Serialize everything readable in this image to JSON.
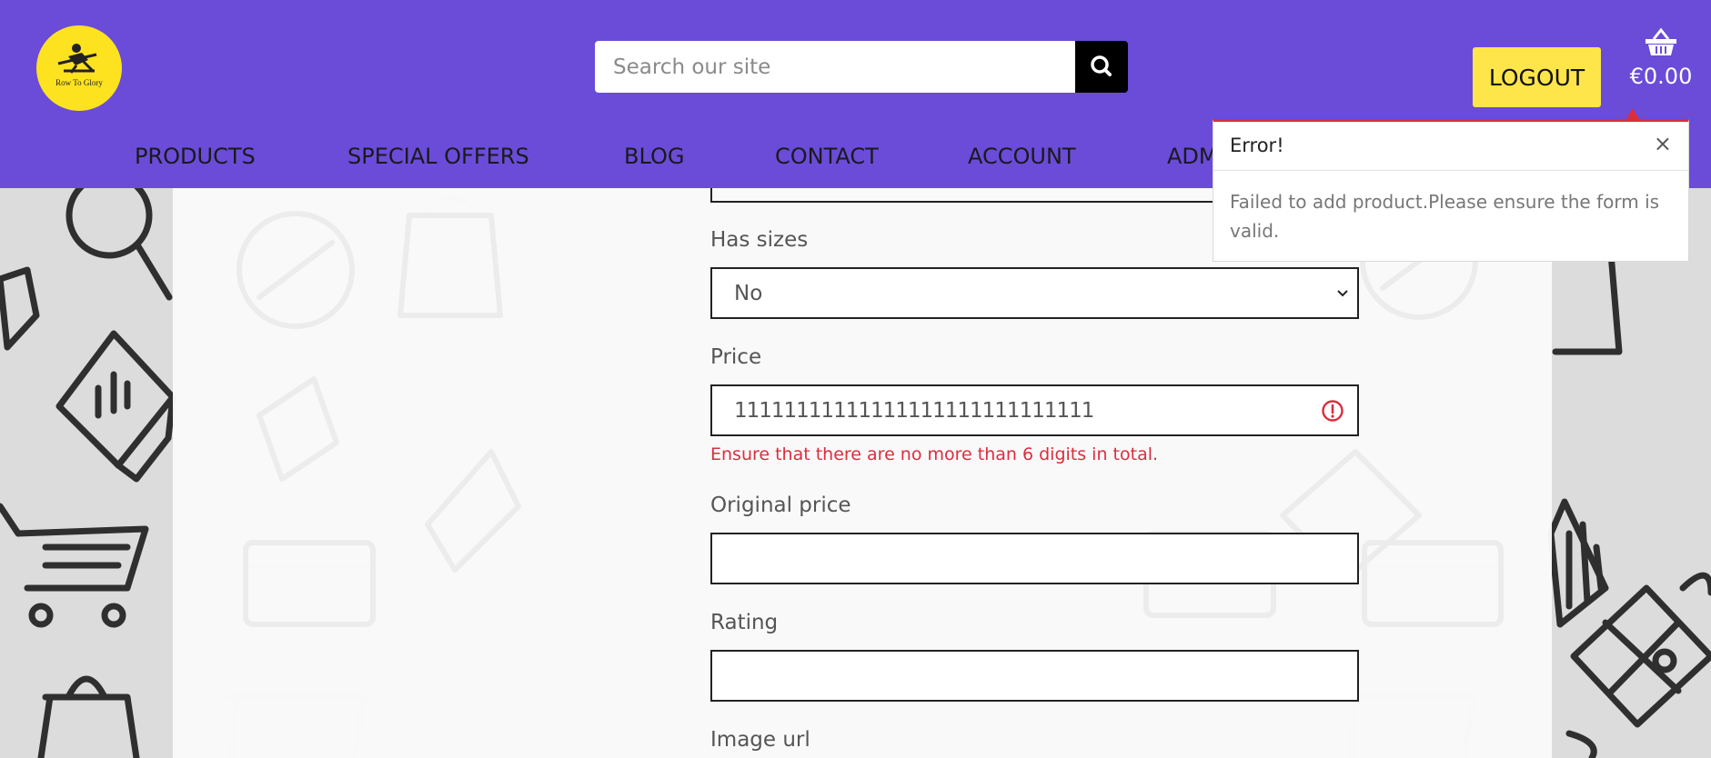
{
  "header": {
    "logo_text": "Row To Glory",
    "search_placeholder": "Search our site",
    "logout_label": "LOGOUT",
    "basket_total": "€0.00",
    "nav": [
      "PRODUCTS",
      "SPECIAL OFFERS",
      "BLOG",
      "CONTACT",
      "ACCOUNT",
      "ADM"
    ]
  },
  "form": {
    "has_sizes": {
      "label": "Has sizes",
      "value": "No"
    },
    "price": {
      "label": "Price",
      "value": "11111111111111111111111111111",
      "error": "Ensure that there are no more than 6 digits in total."
    },
    "original_price": {
      "label": "Original price",
      "value": ""
    },
    "rating": {
      "label": "Rating",
      "value": ""
    },
    "image_url": {
      "label": "Image url"
    }
  },
  "toast": {
    "title": "Error!",
    "close": "×",
    "message": "Failed to add product.Please ensure the form is valid."
  },
  "colors": {
    "header_bg": "#6a4cd8",
    "logo_bg": "#fde21f",
    "logout_bg": "#fde54a",
    "error": "#dc2d3c"
  }
}
